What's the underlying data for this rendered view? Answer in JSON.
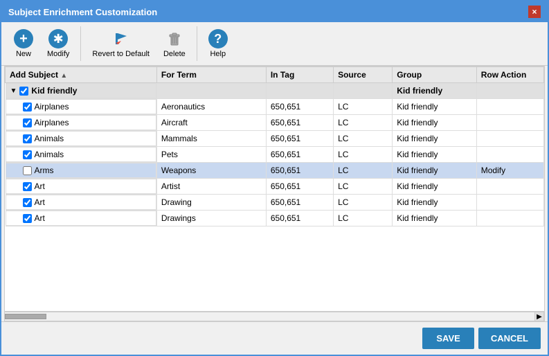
{
  "dialog": {
    "title": "Subject Enrichment Customization",
    "close_label": "×"
  },
  "toolbar": {
    "new_label": "New",
    "modify_label": "Modify",
    "revert_label": "Revert to Default",
    "delete_label": "Delete",
    "help_label": "Help"
  },
  "table": {
    "columns": [
      {
        "id": "add_subject",
        "label": "Add Subject",
        "sortable": true
      },
      {
        "id": "for_term",
        "label": "For Term"
      },
      {
        "id": "in_tag",
        "label": "In Tag"
      },
      {
        "id": "source",
        "label": "Source"
      },
      {
        "id": "group",
        "label": "Group"
      },
      {
        "id": "row_action",
        "label": "Row Action"
      }
    ],
    "rows": [
      {
        "type": "group",
        "checked": true,
        "indeterminate": false,
        "subject": "Kid friendly",
        "for_term": "",
        "in_tag": "",
        "source": "",
        "group": "Kid friendly",
        "row_action": ""
      },
      {
        "type": "data",
        "checked": true,
        "subject": "Airplanes",
        "for_term": "Aeronautics",
        "in_tag": "650,651",
        "source": "LC",
        "group": "Kid friendly",
        "row_action": ""
      },
      {
        "type": "data",
        "checked": true,
        "subject": "Airplanes",
        "for_term": "Aircraft",
        "in_tag": "650,651",
        "source": "LC",
        "group": "Kid friendly",
        "row_action": ""
      },
      {
        "type": "data",
        "checked": true,
        "subject": "Animals",
        "for_term": "Mammals",
        "in_tag": "650,651",
        "source": "LC",
        "group": "Kid friendly",
        "row_action": ""
      },
      {
        "type": "data",
        "checked": true,
        "subject": "Animals",
        "for_term": "Pets",
        "in_tag": "650,651",
        "source": "LC",
        "group": "Kid friendly",
        "row_action": ""
      },
      {
        "type": "data",
        "checked": false,
        "subject": "Arms",
        "for_term": "Weapons",
        "in_tag": "650,651",
        "source": "LC",
        "group": "Kid friendly",
        "row_action": "Modify",
        "highlighted": true
      },
      {
        "type": "data",
        "checked": true,
        "subject": "Art",
        "for_term": "Artist",
        "in_tag": "650,651",
        "source": "LC",
        "group": "Kid friendly",
        "row_action": ""
      },
      {
        "type": "data",
        "checked": true,
        "subject": "Art",
        "for_term": "Drawing",
        "in_tag": "650,651",
        "source": "LC",
        "group": "Kid friendly",
        "row_action": ""
      },
      {
        "type": "data",
        "checked": true,
        "subject": "Art",
        "for_term": "Drawings",
        "in_tag": "650,651",
        "source": "LC",
        "group": "Kid friendly",
        "row_action": ""
      }
    ]
  },
  "footer": {
    "save_label": "SAVE",
    "cancel_label": "CANCEL"
  }
}
